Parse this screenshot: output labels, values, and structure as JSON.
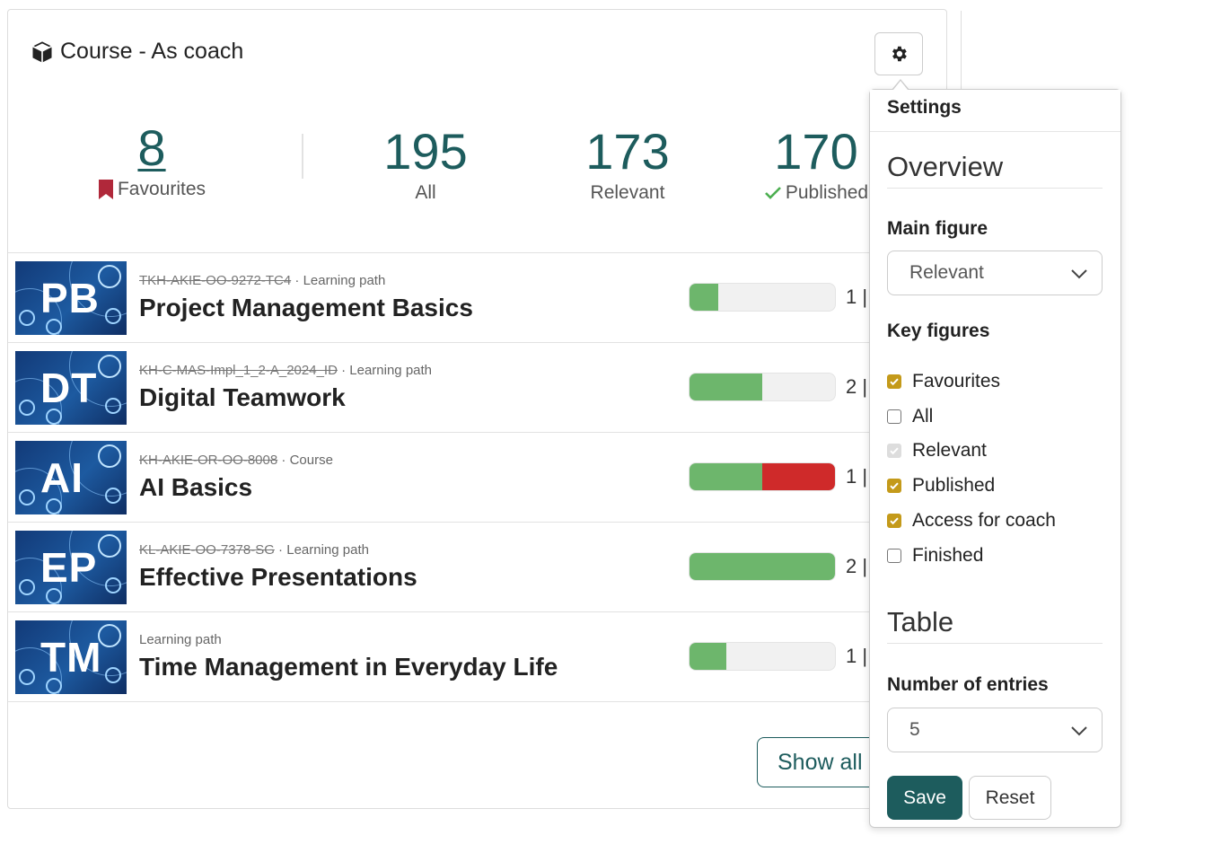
{
  "widget": {
    "title": "Course - As coach",
    "show_all_label": "Show all"
  },
  "key_figures": [
    {
      "value": "8",
      "label": "Favourites",
      "icon": "bookmark-icon",
      "icon_color": "#b0283a"
    },
    {
      "value": "195",
      "label": "All"
    },
    {
      "value": "173",
      "label": "Relevant"
    },
    {
      "value": "170",
      "label": "Published",
      "icon": "check-icon",
      "icon_color": "#4caf50"
    }
  ],
  "courses": [
    {
      "abbr": "PB",
      "code": "TKH-AKIE-OO-9272-TC4",
      "sep": " · ",
      "type": "Learning path",
      "name": "Project Management Basics",
      "green": 0.2,
      "red": 0,
      "count": "1 | "
    },
    {
      "abbr": "DT",
      "code": "KH-C-MAS-Impl_1_2-A_2024_ID",
      "sep": " · ",
      "type": "Learning path",
      "name": "Digital Teamwork",
      "green": 0.5,
      "red": 0,
      "count": "2 | "
    },
    {
      "abbr": "AI",
      "code": "KH-AKIE-OR-OO-8008",
      "sep": " · ",
      "type": "Course",
      "name": "AI Basics",
      "green": 0.5,
      "red": 0.5,
      "count": "1 | "
    },
    {
      "abbr": "EP",
      "code": "KL-AKIE-OO-7378-SG",
      "sep": " · ",
      "type": "Learning path",
      "name": "Effective Presentations",
      "green": 1.0,
      "red": 0,
      "count": "2 | "
    },
    {
      "abbr": "TM",
      "code": "",
      "sep": "",
      "type": "Learning path",
      "name": "Time Management in Everyday Life",
      "green": 0.25,
      "red": 0,
      "count": "1 | "
    }
  ],
  "settings": {
    "header": "Settings",
    "overview_title": "Overview",
    "main_figure_label": "Main figure",
    "main_figure_value": "Relevant",
    "key_figures_label": "Key figures",
    "checks": [
      {
        "label": "Favourites",
        "state": "checked"
      },
      {
        "label": "All",
        "state": "unchecked"
      },
      {
        "label": "Relevant",
        "state": "disabled"
      },
      {
        "label": "Published",
        "state": "checked"
      },
      {
        "label": "Access for coach",
        "state": "checked"
      },
      {
        "label": "Finished",
        "state": "unchecked"
      }
    ],
    "table_title": "Table",
    "entries_label": "Number of entries",
    "entries_value": "5",
    "save_label": "Save",
    "reset_label": "Reset"
  },
  "colors": {
    "accent": "#1d5c5d",
    "check": "#c49a1a",
    "progress_green": "#6db66c",
    "progress_red": "#cf2a2a"
  }
}
